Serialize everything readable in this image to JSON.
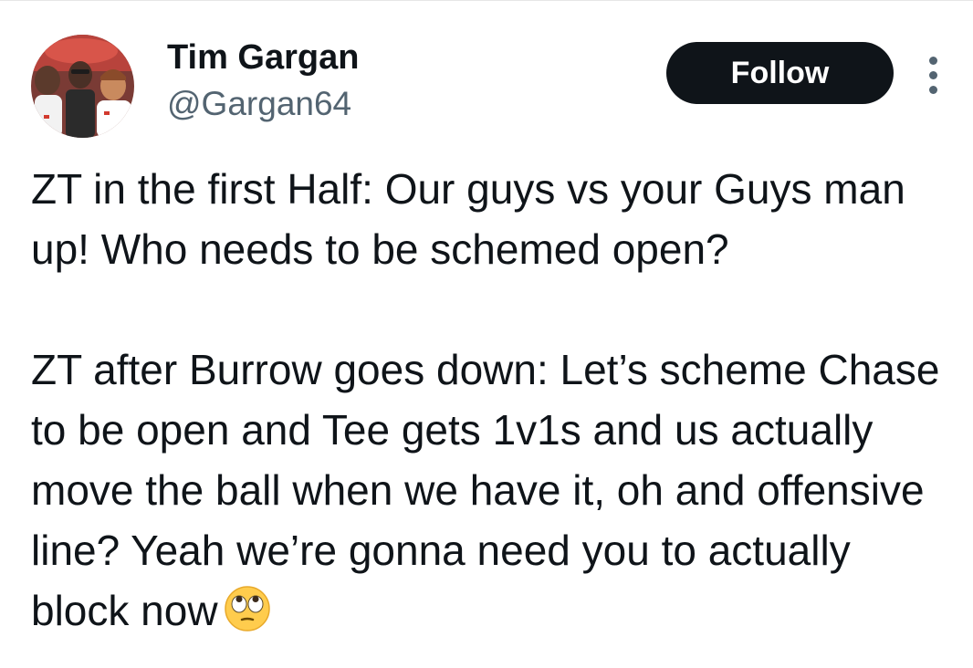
{
  "author": {
    "name": "Tim Gargan",
    "handle": "@Gargan64"
  },
  "actions": {
    "follow_label": "Follow"
  },
  "icons": {
    "more": "more-options-icon",
    "emoji": "face-with-rolling-eyes"
  },
  "colors": {
    "text": "#0f1419",
    "secondary_text": "#536471",
    "follow_bg": "#0f1419",
    "background": "#ffffff"
  },
  "tweet": {
    "paragraphs": [
      "ZT in the first Half: Our guys vs your Guys man up! Who needs to be schemed open?",
      "ZT after Burrow goes down: Let’s scheme Chase to be open and Tee gets 1v1s and us actually move the ball when we have it, oh and offensive line? Yeah we’re gonna need you to actually block now"
    ]
  }
}
